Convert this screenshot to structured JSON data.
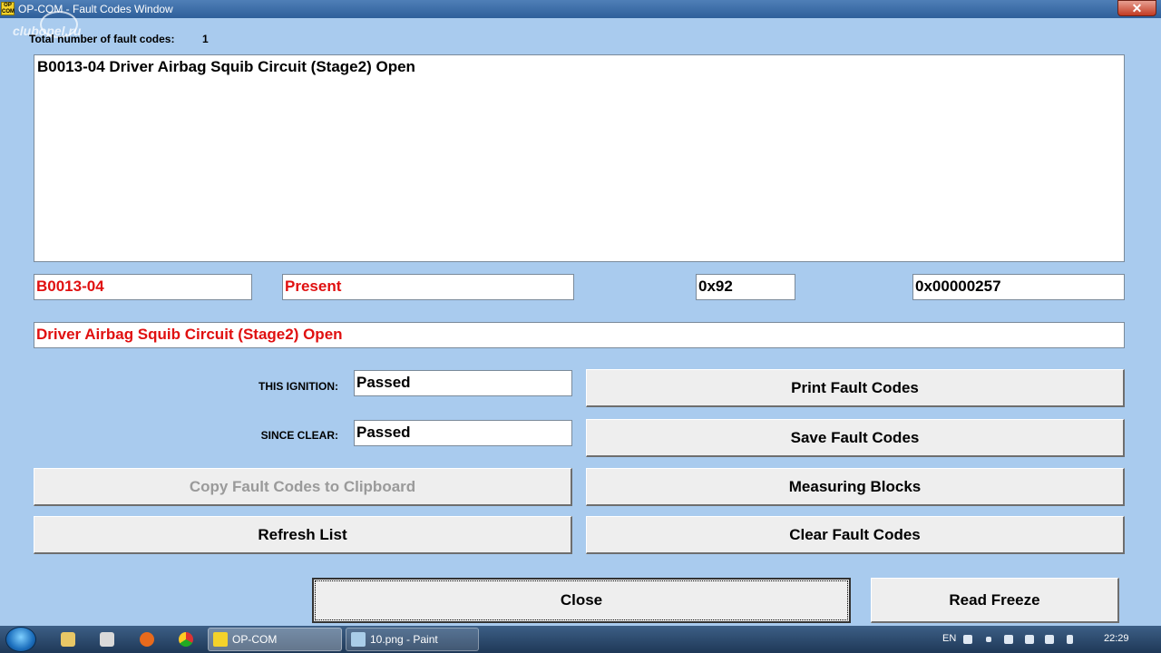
{
  "window": {
    "title": "OP-COM - Fault Codes Window",
    "app_icon_text": "OP COM",
    "close_glyph": "✕"
  },
  "watermark": {
    "text": "clubopel.ru"
  },
  "summary": {
    "label": "Total number of fault codes:",
    "count": "1"
  },
  "fault_list": {
    "items": [
      "B0013-04 Driver Airbag Squib Circuit (Stage2) Open"
    ]
  },
  "details": {
    "code": "B0013-04",
    "status": "Present",
    "hex_byte": "0x92",
    "hex_long": "0x00000257",
    "description": "Driver Airbag Squib Circuit (Stage2) Open",
    "this_ignition_label": "THIS IGNITION:",
    "this_ignition_value": "Passed",
    "since_clear_label": "SINCE CLEAR:",
    "since_clear_value": "Passed"
  },
  "buttons": {
    "print": "Print Fault Codes",
    "save": "Save Fault Codes",
    "copy": "Copy Fault Codes to Clipboard",
    "measuring": "Measuring Blocks",
    "refresh": "Refresh List",
    "clear": "Clear Fault Codes",
    "close": "Close",
    "read_freeze": "Read Freeze"
  },
  "taskbar": {
    "tasks": [
      {
        "label": "OP-COM",
        "active": true
      },
      {
        "label": "10.png - Paint",
        "active": false
      }
    ],
    "language": "EN",
    "clock": "22:29"
  },
  "colors": {
    "window_bg": "#a9cbee",
    "alert_text": "#e01010"
  }
}
